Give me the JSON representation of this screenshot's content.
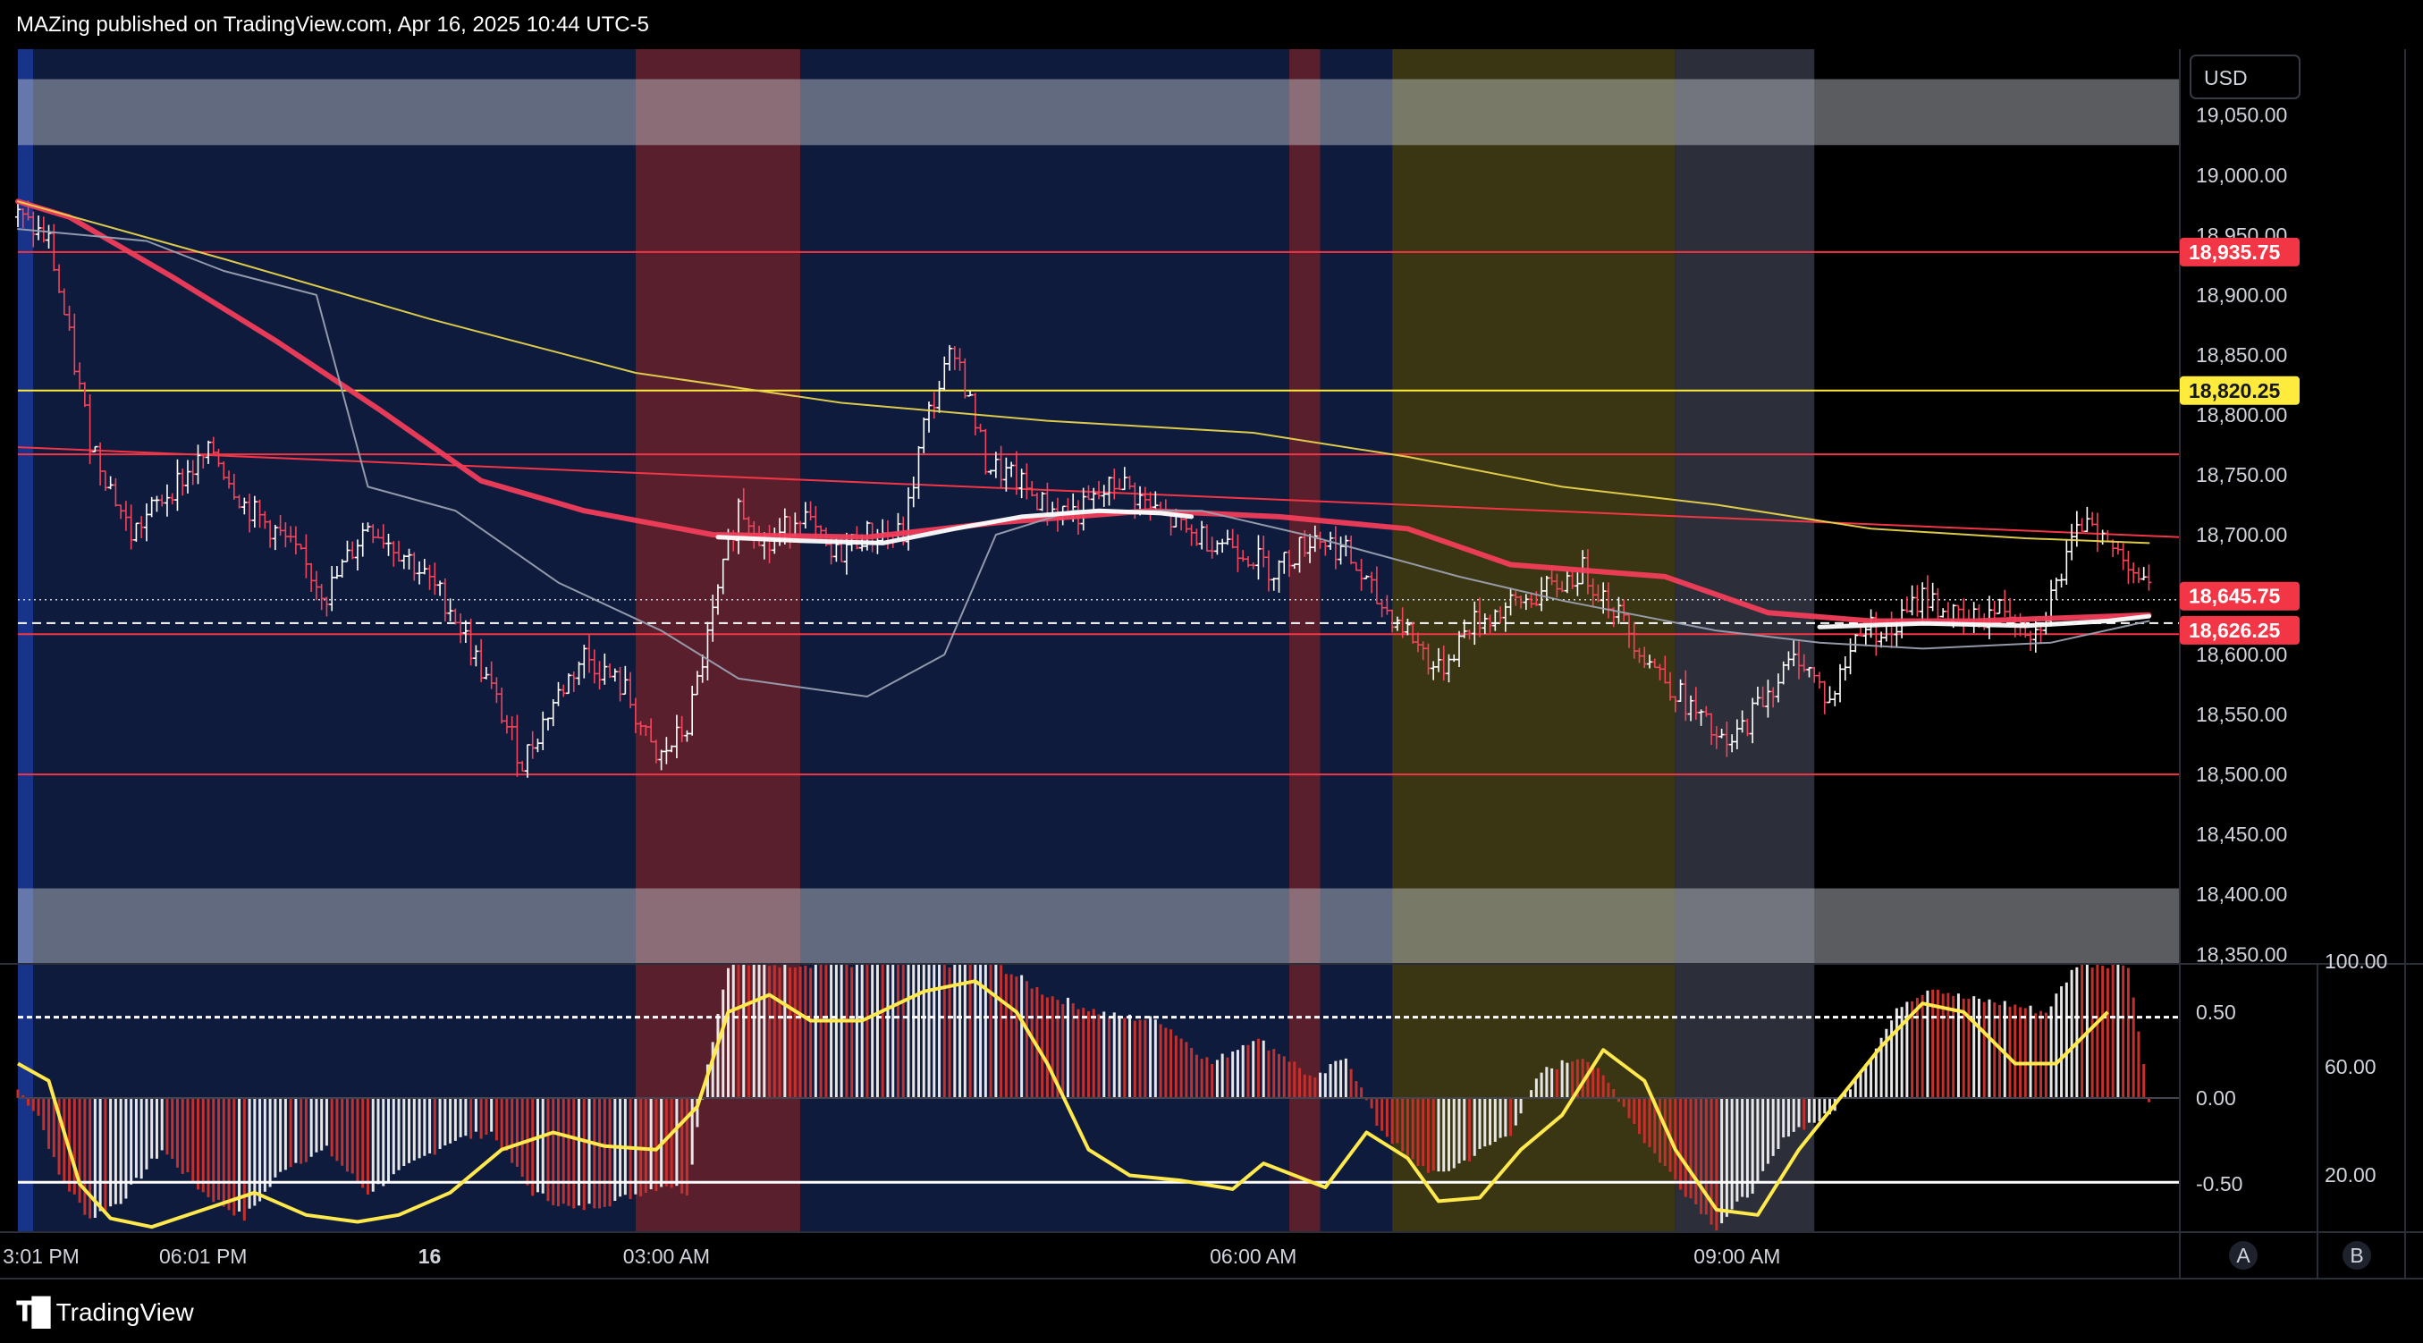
{
  "header": {
    "text": "MAZing published on TradingView.com, Apr 16, 2025 10:44 UTC-5"
  },
  "footer": {
    "logo_text": "TradingView"
  },
  "currency_button": "USD",
  "corner_buttons": [
    "A",
    "B"
  ],
  "colors": {
    "background": "#000000",
    "session_navy": "#0f1b3d",
    "session_red": "#5a1f2c",
    "session_olive": "#3a3512",
    "session_gray": "#2c2f3a",
    "level_red": "#f23645",
    "level_yellow": "#ffeb3b",
    "ma_red": "#f23d5a",
    "ma_yellow": "#e8d44d",
    "ma_gray": "#9aa0b0",
    "vwap_white": "#ffffff",
    "hist_red": "#c4302b",
    "hist_white": "#e6e6e6",
    "osc_yellow": "#ffe94d"
  },
  "chart_data": [
    {
      "type": "line",
      "panel": "price",
      "y_axis": {
        "ticks": [
          "19,050.00",
          "19,000.00",
          "18,950.00",
          "18,900.00",
          "18,850.00",
          "18,800.00",
          "18,750.00",
          "18,700.00",
          "18,650.00",
          "18,600.00",
          "18,550.00",
          "18,500.00",
          "18,450.00",
          "18,400.00",
          "18,350.00"
        ],
        "range": [
          18342,
          19105
        ]
      },
      "x_axis": {
        "labels": [
          {
            "label": "3:01 PM",
            "bar": 0
          },
          {
            "label": "06:01 PM",
            "bar": 36
          },
          {
            "label": "16",
            "bar": 80
          },
          {
            "label": "03:00 AM",
            "bar": 126
          },
          {
            "label": "06:00 AM",
            "bar": 240
          },
          {
            "label": "09:00 AM",
            "bar": 334
          }
        ],
        "bars": 420
      },
      "price_labels": [
        {
          "text": "18,935.75",
          "value": 18935.75,
          "color": "#f23645"
        },
        {
          "text": "18,820.25",
          "value": 18820.25,
          "color": "#ffeb3b"
        },
        {
          "text": "18,645.75",
          "value": 18645.75,
          "color": "#f23645"
        },
        {
          "text": "18,626.25",
          "value": 18626.25,
          "color": "#f23645"
        }
      ],
      "horizontal_levels": [
        {
          "value": 18935.75,
          "color": "#f23645"
        },
        {
          "value": 18820.25,
          "color": "#ffeb3b"
        },
        {
          "value": 18767,
          "color": "#f23645"
        },
        {
          "value": 18617,
          "color": "#f23645"
        },
        {
          "value": 18500,
          "color": "#f23645"
        }
      ],
      "trendline": {
        "from": [
          0,
          18773
        ],
        "to": [
          420,
          18698
        ]
      },
      "current_price": 18645.75,
      "ohlc_path": [
        [
          0,
          18965
        ],
        [
          6,
          18945
        ],
        [
          14,
          18780
        ],
        [
          22,
          18700
        ],
        [
          30,
          18740
        ],
        [
          38,
          18770
        ],
        [
          44,
          18725
        ],
        [
          52,
          18695
        ],
        [
          60,
          18650
        ],
        [
          68,
          18710
        ],
        [
          76,
          18680
        ],
        [
          84,
          18640
        ],
        [
          92,
          18570
        ],
        [
          98,
          18510
        ],
        [
          104,
          18560
        ],
        [
          110,
          18600
        ],
        [
          118,
          18570
        ],
        [
          124,
          18510
        ],
        [
          130,
          18540
        ],
        [
          136,
          18650
        ],
        [
          140,
          18725
        ],
        [
          146,
          18690
        ],
        [
          152,
          18720
        ],
        [
          158,
          18680
        ],
        [
          164,
          18700
        ],
        [
          172,
          18700
        ],
        [
          176,
          18790
        ],
        [
          182,
          18858
        ],
        [
          188,
          18760
        ],
        [
          194,
          18745
        ],
        [
          200,
          18722
        ],
        [
          206,
          18718
        ],
        [
          214,
          18745
        ],
        [
          220,
          18722
        ],
        [
          228,
          18700
        ],
        [
          236,
          18693
        ],
        [
          244,
          18670
        ],
        [
          252,
          18700
        ],
        [
          258,
          18685
        ],
        [
          264,
          18645
        ],
        [
          270,
          18620
        ],
        [
          276,
          18585
        ],
        [
          282,
          18625
        ],
        [
          290,
          18640
        ],
        [
          298,
          18655
        ],
        [
          304,
          18670
        ],
        [
          310,
          18640
        ],
        [
          316,
          18600
        ],
        [
          324,
          18560
        ],
        [
          332,
          18520
        ],
        [
          340,
          18570
        ],
        [
          346,
          18600
        ],
        [
          352,
          18560
        ],
        [
          358,
          18625
        ],
        [
          364,
          18618
        ],
        [
          370,
          18650
        ],
        [
          378,
          18625
        ],
        [
          386,
          18640
        ],
        [
          392,
          18618
        ],
        [
          398,
          18678
        ],
        [
          402,
          18720
        ],
        [
          406,
          18690
        ],
        [
          410,
          18680
        ],
        [
          414,
          18650
        ]
      ],
      "series": [
        {
          "name": "",
          "color": "#f23d5a",
          "width": 6,
          "points": [
            [
              0,
              18978
            ],
            [
              10,
              18965
            ],
            [
              30,
              18915
            ],
            [
              50,
              18862
            ],
            [
              70,
              18805
            ],
            [
              90,
              18745
            ],
            [
              110,
              18720
            ],
            [
              135,
              18700
            ],
            [
              165,
              18698
            ],
            [
              190,
              18710
            ],
            [
              220,
              18720
            ],
            [
              245,
              18715
            ],
            [
              270,
              18705
            ],
            [
              290,
              18675
            ],
            [
              320,
              18665
            ],
            [
              340,
              18635
            ],
            [
              360,
              18628
            ],
            [
              380,
              18628
            ],
            [
              414,
              18633
            ]
          ]
        },
        {
          "name": "",
          "color": "#e8d44d",
          "width": 2,
          "points": [
            [
              0,
              18978
            ],
            [
              40,
              18930
            ],
            [
              80,
              18880
            ],
            [
              120,
              18835
            ],
            [
              160,
              18810
            ],
            [
              200,
              18795
            ],
            [
              240,
              18785
            ],
            [
              270,
              18765
            ],
            [
              300,
              18740
            ],
            [
              330,
              18725
            ],
            [
              360,
              18705
            ],
            [
              390,
              18697
            ],
            [
              414,
              18693
            ]
          ]
        },
        {
          "name": "",
          "color": "#9aa0b0",
          "width": 2,
          "points": [
            [
              0,
              18955
            ],
            [
              25,
              18945
            ],
            [
              40,
              18920
            ],
            [
              58,
              18900
            ],
            [
              68,
              18740
            ],
            [
              85,
              18720
            ],
            [
              105,
              18660
            ],
            [
              125,
              18620
            ],
            [
              140,
              18580
            ],
            [
              165,
              18565
            ],
            [
              180,
              18600
            ],
            [
              190,
              18700
            ],
            [
              205,
              18720
            ],
            [
              230,
              18720
            ],
            [
              250,
              18700
            ],
            [
              280,
              18665
            ],
            [
              300,
              18645
            ],
            [
              330,
              18620
            ],
            [
              350,
              18610
            ],
            [
              370,
              18605
            ],
            [
              395,
              18610
            ],
            [
              414,
              18628
            ]
          ]
        },
        {
          "name": "",
          "color": "#ffffff",
          "width": 5,
          "points": [
            [
              136,
              18698
            ],
            [
              152,
              18695
            ],
            [
              168,
              18693
            ],
            [
              182,
              18705
            ],
            [
              195,
              18715
            ],
            [
              210,
              18720
            ],
            [
              222,
              18718
            ],
            [
              228,
              18715
            ]
          ]
        },
        {
          "name": "",
          "color": "#ffffff",
          "width": 5,
          "points": [
            [
              350,
              18623
            ],
            [
              370,
              18626
            ],
            [
              390,
              18624
            ],
            [
              406,
              18628
            ],
            [
              414,
              18632
            ]
          ]
        }
      ],
      "sessions": [
        {
          "from": 0,
          "to": 3,
          "color": "#17338a"
        },
        {
          "from": 3,
          "to": 120,
          "color": "#0f1b3d"
        },
        {
          "from": 120,
          "to": 152,
          "color": "#5a1f2c"
        },
        {
          "from": 152,
          "to": 247,
          "color": "#0f1b3d"
        },
        {
          "from": 247,
          "to": 253,
          "color": "#5a1f2c"
        },
        {
          "from": 253,
          "to": 267,
          "color": "#0f1b3d"
        },
        {
          "from": 267,
          "to": 322,
          "color": "#3a3512"
        },
        {
          "from": 322,
          "to": 349,
          "color": "#2c2f3a"
        }
      ],
      "zones": [
        {
          "from_price": 19025,
          "to_price": 19080,
          "color": "#c8cbd2"
        },
        {
          "from_price": 18342,
          "to_price": 18405,
          "color": "#c8cbd2"
        }
      ]
    },
    {
      "type": "bar",
      "panel": "oscillator",
      "left_axis_ticks": [
        "0.50",
        "0.00",
        "-0.50"
      ],
      "right_axis_ticks": [
        "100.00",
        "60.00",
        "20.00"
      ],
      "range": [
        -0.78,
        0.78
      ],
      "reference_lines": [
        0.47,
        -0.49
      ],
      "histogram_path": [
        [
          0,
          0.05
        ],
        [
          4,
          -0.1
        ],
        [
          8,
          -0.45
        ],
        [
          14,
          -0.7
        ],
        [
          20,
          -0.6
        ],
        [
          28,
          -0.3
        ],
        [
          36,
          -0.55
        ],
        [
          44,
          -0.7
        ],
        [
          52,
          -0.4
        ],
        [
          60,
          -0.3
        ],
        [
          68,
          -0.55
        ],
        [
          76,
          -0.4
        ],
        [
          84,
          -0.25
        ],
        [
          92,
          -0.2
        ],
        [
          100,
          -0.55
        ],
        [
          108,
          -0.65
        ],
        [
          116,
          -0.6
        ],
        [
          126,
          -0.5
        ],
        [
          130,
          -0.55
        ],
        [
          134,
          0.2
        ],
        [
          138,
          0.78
        ],
        [
          146,
          0.78
        ],
        [
          160,
          0.78
        ],
        [
          176,
          0.78
        ],
        [
          190,
          0.78
        ],
        [
          200,
          0.6
        ],
        [
          212,
          0.48
        ],
        [
          222,
          0.45
        ],
        [
          232,
          0.2
        ],
        [
          240,
          0.35
        ],
        [
          246,
          0.25
        ],
        [
          252,
          0.1
        ],
        [
          258,
          0.25
        ],
        [
          264,
          -0.15
        ],
        [
          270,
          -0.35
        ],
        [
          276,
          -0.45
        ],
        [
          282,
          -0.35
        ],
        [
          290,
          -0.2
        ],
        [
          296,
          0.15
        ],
        [
          304,
          0.25
        ],
        [
          310,
          0.05
        ],
        [
          316,
          -0.25
        ],
        [
          324,
          -0.55
        ],
        [
          330,
          -0.75
        ],
        [
          338,
          -0.5
        ],
        [
          344,
          -0.2
        ],
        [
          352,
          -0.1
        ],
        [
          360,
          0.25
        ],
        [
          366,
          0.55
        ],
        [
          372,
          0.65
        ],
        [
          378,
          0.58
        ],
        [
          386,
          0.55
        ],
        [
          394,
          0.5
        ],
        [
          400,
          0.78
        ],
        [
          410,
          0.78
        ],
        [
          414,
          0.0
        ]
      ],
      "signal_path": [
        [
          0,
          0.2
        ],
        [
          6,
          0.1
        ],
        [
          12,
          -0.5
        ],
        [
          18,
          -0.7
        ],
        [
          26,
          -0.75
        ],
        [
          36,
          -0.65
        ],
        [
          46,
          -0.55
        ],
        [
          56,
          -0.68
        ],
        [
          66,
          -0.72
        ],
        [
          74,
          -0.68
        ],
        [
          84,
          -0.55
        ],
        [
          94,
          -0.3
        ],
        [
          104,
          -0.2
        ],
        [
          114,
          -0.28
        ],
        [
          124,
          -0.3
        ],
        [
          132,
          -0.05
        ],
        [
          138,
          0.5
        ],
        [
          146,
          0.6
        ],
        [
          154,
          0.45
        ],
        [
          164,
          0.45
        ],
        [
          176,
          0.62
        ],
        [
          186,
          0.68
        ],
        [
          194,
          0.5
        ],
        [
          200,
          0.2
        ],
        [
          208,
          -0.3
        ],
        [
          216,
          -0.45
        ],
        [
          226,
          -0.48
        ],
        [
          236,
          -0.53
        ],
        [
          242,
          -0.38
        ],
        [
          248,
          -0.45
        ],
        [
          254,
          -0.52
        ],
        [
          262,
          -0.2
        ],
        [
          270,
          -0.35
        ],
        [
          276,
          -0.6
        ],
        [
          284,
          -0.58
        ],
        [
          292,
          -0.3
        ],
        [
          300,
          -0.1
        ],
        [
          308,
          0.28
        ],
        [
          316,
          0.1
        ],
        [
          322,
          -0.3
        ],
        [
          330,
          -0.65
        ],
        [
          338,
          -0.68
        ],
        [
          346,
          -0.3
        ],
        [
          354,
          0.0
        ],
        [
          362,
          0.3
        ],
        [
          370,
          0.55
        ],
        [
          378,
          0.5
        ],
        [
          388,
          0.2
        ],
        [
          396,
          0.2
        ],
        [
          406,
          0.5
        ]
      ]
    }
  ]
}
